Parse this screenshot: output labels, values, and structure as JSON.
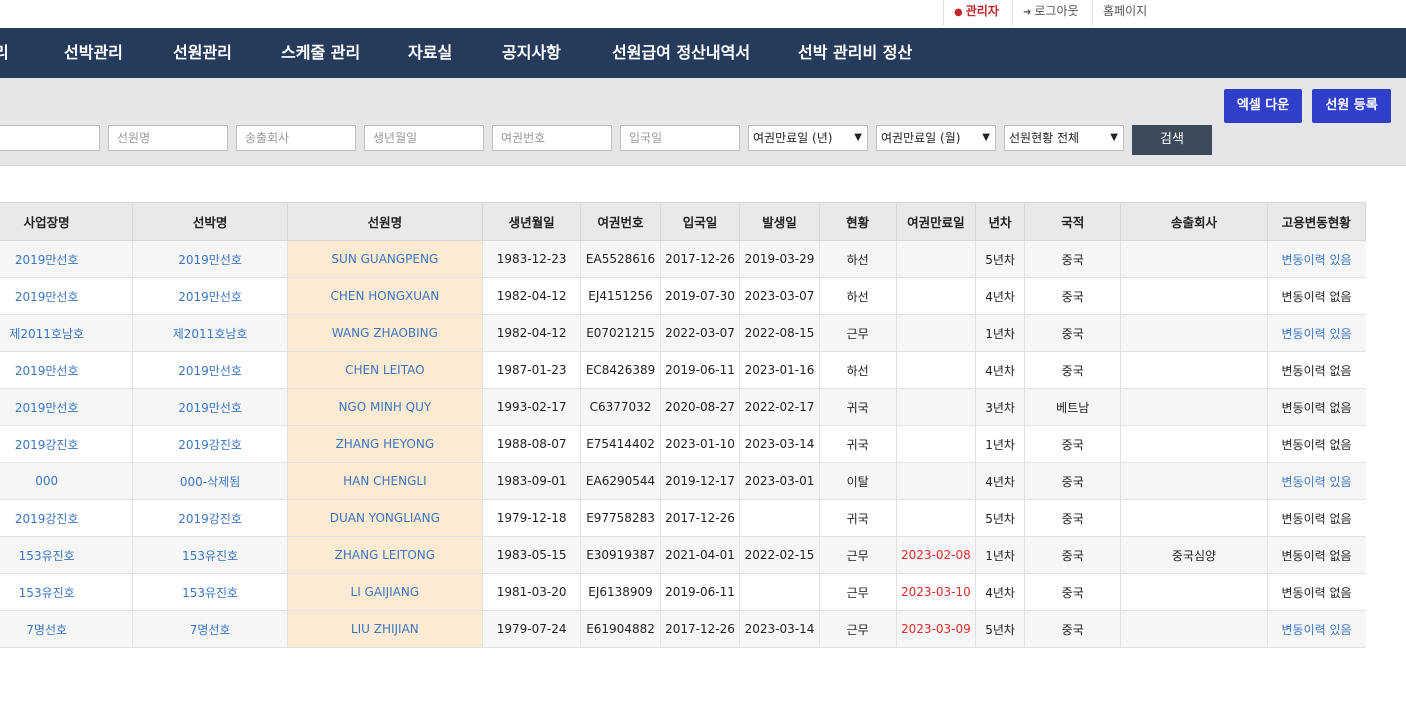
{
  "topbar": {
    "admin": "관리자",
    "logout": "로그아웃",
    "home": "홈페이지"
  },
  "nav": {
    "items": [
      "리",
      "선박관리",
      "선원관리",
      "스케줄 관리",
      "자료실",
      "공지사항",
      "선원급여 정산내역서",
      "선박 관리비 정산"
    ]
  },
  "filter": {
    "excel_label": "엑셀 다운",
    "register_label": "선원 등록",
    "crew_placeholder": "선원명",
    "agency_placeholder": "송출회사",
    "birth_placeholder": "생년월일",
    "passport_placeholder": "여권번호",
    "entry_placeholder": "입국일",
    "expiry_year_value": "여권만료일 (년)",
    "expiry_month_value": "여권만료일 (월)",
    "status_value": "선원현황 전체",
    "search_label": "검색"
  },
  "table": {
    "headers": [
      "사업장명",
      "선박명",
      "선원명",
      "생년월일",
      "여권번호",
      "입국일",
      "발생일",
      "현황",
      "여권만료일",
      "년차",
      "국적",
      "송출회사",
      "고용변동현황"
    ],
    "rows": [
      {
        "company": "2019만선호",
        "ship": "2019만선호",
        "crew": "SUN GUANGPENG",
        "birth": "1983-12-23",
        "passport": "EA5528616",
        "entry": "2017-12-26",
        "occurred": "2019-03-29",
        "status": "하선",
        "expiry": "",
        "year": "5년차",
        "nation": "중국",
        "agency": "",
        "history": "변동이력 있음"
      },
      {
        "company": "2019만선호",
        "ship": "2019만선호",
        "crew": "CHEN HONGXUAN",
        "birth": "1982-04-12",
        "passport": "EJ4151256",
        "entry": "2019-07-30",
        "occurred": "2023-03-07",
        "status": "하선",
        "expiry": "",
        "year": "4년차",
        "nation": "중국",
        "agency": "",
        "history": "변동이력 없음"
      },
      {
        "company": "제2011호남호",
        "ship": "제2011호남호",
        "crew": "WANG ZHAOBING",
        "birth": "1982-04-12",
        "passport": "E07021215",
        "entry": "2022-03-07",
        "occurred": "2022-08-15",
        "status": "근무",
        "expiry": "",
        "year": "1년차",
        "nation": "중국",
        "agency": "",
        "history": "변동이력 있음"
      },
      {
        "company": "2019만선호",
        "ship": "2019만선호",
        "crew": "CHEN LEITAO",
        "birth": "1987-01-23",
        "passport": "EC8426389",
        "entry": "2019-06-11",
        "occurred": "2023-01-16",
        "status": "하선",
        "expiry": "",
        "year": "4년차",
        "nation": "중국",
        "agency": "",
        "history": "변동이력 없음"
      },
      {
        "company": "2019만선호",
        "ship": "2019만선호",
        "crew": "NGO MINH QUY",
        "birth": "1993-02-17",
        "passport": "C6377032",
        "entry": "2020-08-27",
        "occurred": "2022-02-17",
        "status": "귀국",
        "expiry": "",
        "year": "3년차",
        "nation": "베트남",
        "agency": "",
        "history": "변동이력 없음"
      },
      {
        "company": "2019강진호",
        "ship": "2019강진호",
        "crew": "ZHANG HEYONG",
        "birth": "1988-08-07",
        "passport": "E75414402",
        "entry": "2023-01-10",
        "occurred": "2023-03-14",
        "status": "귀국",
        "expiry": "",
        "year": "1년차",
        "nation": "중국",
        "agency": "",
        "history": "변동이력 없음"
      },
      {
        "company": "000",
        "ship": "000-삭제됨",
        "crew": "HAN CHENGLI",
        "birth": "1983-09-01",
        "passport": "EA6290544",
        "entry": "2019-12-17",
        "occurred": "2023-03-01",
        "status": "이탈",
        "expiry": "",
        "year": "4년차",
        "nation": "중국",
        "agency": "",
        "history": "변동이력 있음"
      },
      {
        "company": "2019강진호",
        "ship": "2019강진호",
        "crew": "DUAN YONGLIANG",
        "birth": "1979-12-18",
        "passport": "E97758283",
        "entry": "2017-12-26",
        "occurred": "",
        "status": "귀국",
        "expiry": "",
        "year": "5년차",
        "nation": "중국",
        "agency": "",
        "history": "변동이력 없음"
      },
      {
        "company": "153유진호",
        "ship": "153유진호",
        "crew": "ZHANG LEITONG",
        "birth": "1983-05-15",
        "passport": "E30919387",
        "entry": "2021-04-01",
        "occurred": "2022-02-15",
        "status": "근무",
        "expiry": "2023-02-08",
        "year": "1년차",
        "nation": "중국",
        "agency": "중국심양",
        "history": "변동이력 없음"
      },
      {
        "company": "153유진호",
        "ship": "153유진호",
        "crew": "LI GAIJIANG",
        "birth": "1981-03-20",
        "passport": "EJ6138909",
        "entry": "2019-06-11",
        "occurred": "",
        "status": "근무",
        "expiry": "2023-03-10",
        "year": "4년차",
        "nation": "중국",
        "agency": "",
        "history": "변동이력 없음"
      },
      {
        "company": "7명선호",
        "ship": "7명선호",
        "crew": "LIU ZHIJIAN",
        "birth": "1979-07-24",
        "passport": "E61904882",
        "entry": "2017-12-26",
        "occurred": "2023-03-14",
        "status": "근무",
        "expiry": "2023-03-09",
        "year": "5년차",
        "nation": "중국",
        "agency": "",
        "history": "변동이력 있음"
      }
    ]
  },
  "colors": {
    "nav_bg": "#263a5b",
    "button_blue": "#2f3fc9",
    "link_blue": "#3a76c4",
    "expiry_red": "#e52b2b",
    "crew_highlight": "#fcebd2"
  }
}
